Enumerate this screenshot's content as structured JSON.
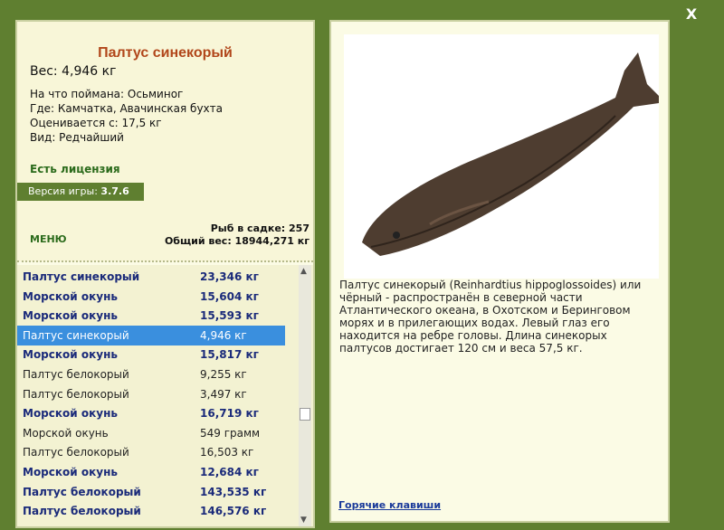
{
  "close_label": "X",
  "fish": {
    "title": "Палтус синекорый",
    "weight": "Вес: 4,946 кг",
    "caught_on": "На что поймана: Осьминог",
    "location": "Где: Камчатка, Авачинская бухта",
    "price": "Оценивается с: 17,5 кг",
    "rarity": "Вид: Редчайший"
  },
  "license": "Есть лицензия",
  "version": {
    "label": "Версия игры:",
    "value": "3.7.6"
  },
  "menu_label": "МЕНЮ",
  "totals": {
    "in_keepnet": "Рыб в садке: 257",
    "total_weight": "Общий вес: 18944,271 кг"
  },
  "catch_list": [
    {
      "name": "Палтус синекорый",
      "weight": "23,346 кг",
      "bold": true
    },
    {
      "name": "Морской окунь",
      "weight": "15,604 кг",
      "bold": true
    },
    {
      "name": "Морской окунь",
      "weight": "15,593 кг",
      "bold": true
    },
    {
      "name": "Палтус синекорый",
      "weight": "4,946 кг",
      "bold": false,
      "selected": true
    },
    {
      "name": "Морской окунь",
      "weight": "15,817 кг",
      "bold": true
    },
    {
      "name": "Палтус белокорый",
      "weight": "9,255 кг",
      "bold": false
    },
    {
      "name": "Палтус белокорый",
      "weight": "3,497 кг",
      "bold": false
    },
    {
      "name": "Морской окунь",
      "weight": "16,719 кг",
      "bold": true
    },
    {
      "name": "Морской окунь",
      "weight": "549 грамм",
      "bold": false
    },
    {
      "name": "Палтус белокорый",
      "weight": "16,503 кг",
      "bold": false
    },
    {
      "name": "Морской окунь",
      "weight": "12,684 кг",
      "bold": true
    },
    {
      "name": "Палтус белокорый",
      "weight": "143,535 кг",
      "bold": true
    },
    {
      "name": "Палтус белокорый",
      "weight": "146,576 кг",
      "bold": true
    }
  ],
  "description": "Палтус синекорый (Reinhardtius hippoglossoides) или чёрный - распространён в северной части Атлантического океана, в Охотском и Беринговом морях и в прилегающих водах. Левый глаз его находится на ребре головы. Длина синекорых палтусов достигает 120 см и веса 57,5 кг.",
  "hotkeys": "Горячие клавиши",
  "colors": {
    "frame": "#5f7f30",
    "title": "#b1461a",
    "selected": "#3a8fde",
    "bold_row": "#1a2a7a"
  }
}
